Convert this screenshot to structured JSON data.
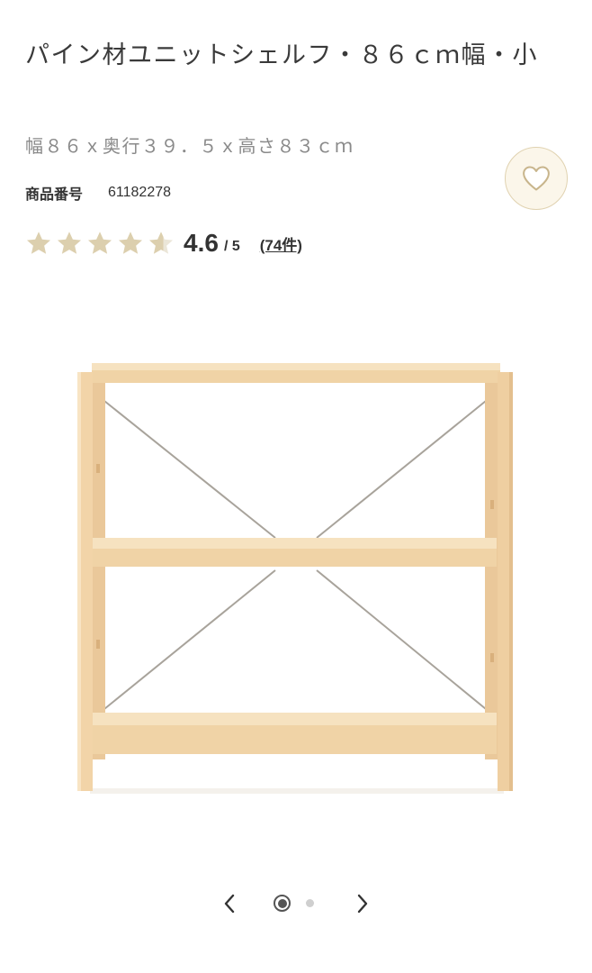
{
  "product": {
    "title": "パイン材ユニットシェルフ・８６ｃｍ幅・小",
    "spec": "幅８６ｘ奥行３９．５ｘ高さ８３ｃｍ",
    "code_label": "商品番号",
    "code_value": "61182278"
  },
  "rating": {
    "score": "4.6",
    "max": "/ 5",
    "review_count": "(74件)",
    "value": 4.6,
    "star_color": "#dccfae",
    "star_empty_color": "#ebe6d8"
  },
  "favorite": {
    "icon": "heart-icon",
    "bg_color": "#fbf6ea",
    "border_color": "#e0d2b0"
  },
  "carousel": {
    "prev_icon": "chevron-left-icon",
    "next_icon": "chevron-right-icon",
    "total_slides": 2,
    "current_slide": 1
  },
  "image": {
    "subject": "pine unit shelf, 3 shelves with cross braces",
    "wood_color": "#f3d8ae"
  }
}
